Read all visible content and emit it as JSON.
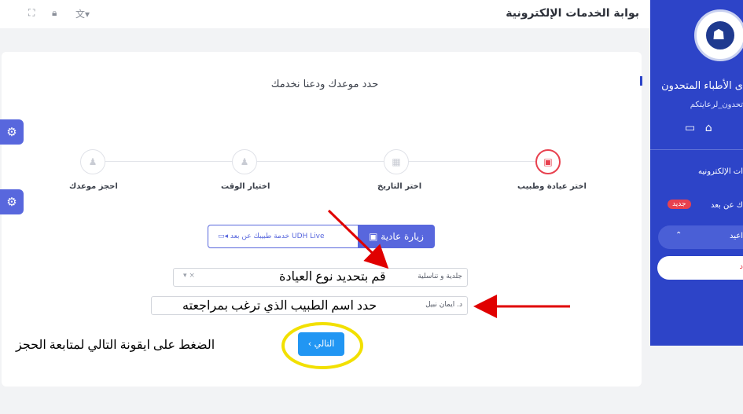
{
  "header": {
    "site_title": "بوابة الخدمات الإلكترونية",
    "icons": [
      "expand-icon",
      "lock-icon",
      "language-icon"
    ]
  },
  "sidebar": {
    "org_name": "ى الأطباء المتحدون",
    "tagline": "تحدون_لرعايتكم",
    "eservices_label": "ات الإلكترونيه",
    "remote_label": "ك عن بعد",
    "new_badge": "جديد",
    "clinics_label": "اعيد",
    "book_label": "د",
    "brand_color": "#2d44c8"
  },
  "main": {
    "title": "حدد موعدك ودعنا نخدمك",
    "steps": [
      {
        "label": "اختر عيادة وطبيب",
        "active": true
      },
      {
        "label": "اختر التاريخ",
        "active": false
      },
      {
        "label": "اختيار الوقت",
        "active": false
      },
      {
        "label": "احجز موعدك",
        "active": false
      }
    ],
    "visit_tabs": {
      "regular": "زيارة عادية",
      "remote": "خدمة طبيبك عن بعد UDH Live"
    },
    "clinic_select": {
      "value": "جلدية و تناسلية"
    },
    "doctor_select": {
      "value": "د. ايمان نبيل"
    },
    "next_button": "التالي ›"
  },
  "annotations": {
    "clinic_note": "قم بتحديد نوع العيادة",
    "doctor_note": "حدد اسم الطبيب الذي ترغب بمراجعته",
    "next_note": "الضغط على ايقونة التالي لمتابعة الحجز",
    "arrow_color": "#e00000",
    "circle_color": "#f2e000"
  }
}
